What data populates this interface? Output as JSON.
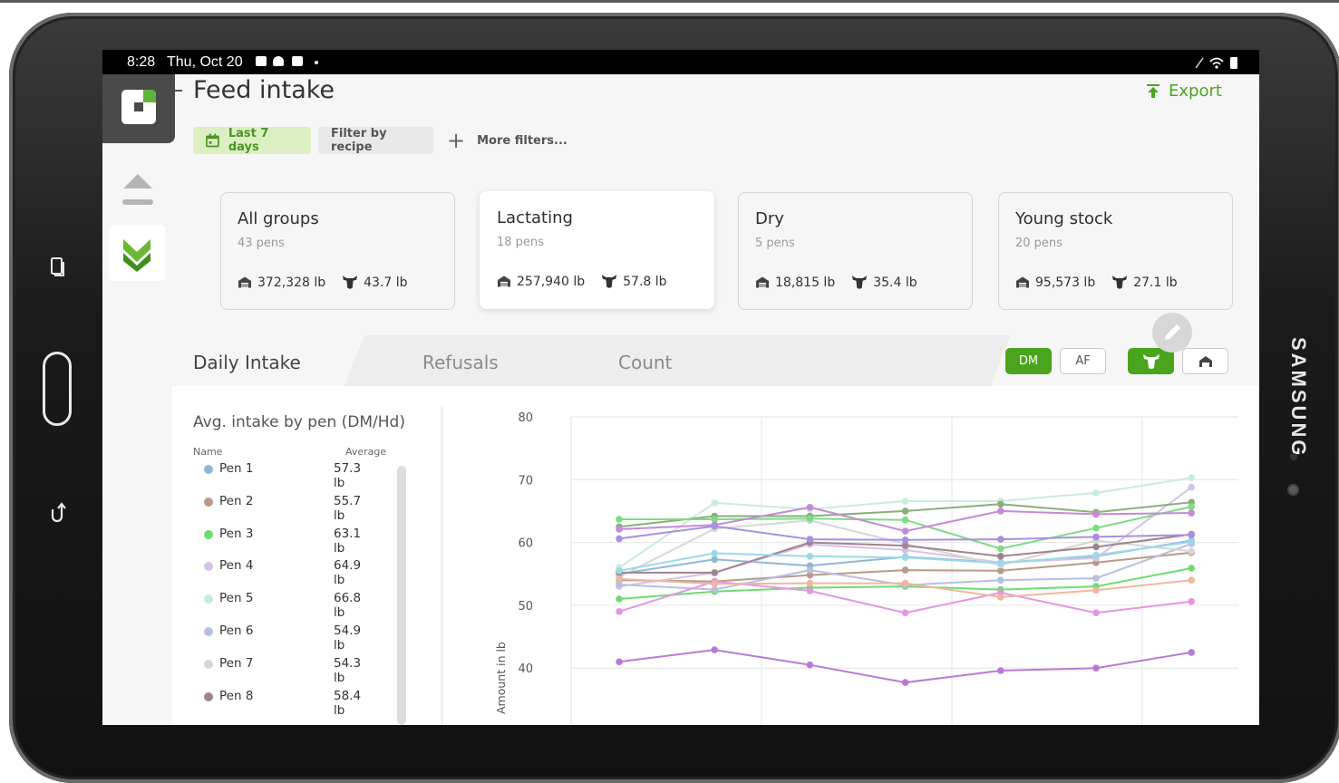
{
  "status_bar": {
    "time": "8:28",
    "date": "Thu, Oct 20"
  },
  "device_brand": "SAMSUNG",
  "page": {
    "title": "Feed intake",
    "export_label": "Export"
  },
  "filters": {
    "date_range": "Last 7 days",
    "recipe": "Filter by recipe",
    "more": "More filters..."
  },
  "groups": [
    {
      "name": "All groups",
      "pens": "43 pens",
      "total": "372,328 lb",
      "per_head": "43.7 lb",
      "active": false
    },
    {
      "name": "Lactating",
      "pens": "18 pens",
      "total": "257,940 lb",
      "per_head": "57.8 lb",
      "active": true
    },
    {
      "name": "Dry",
      "pens": "5 pens",
      "total": "18,815 lb",
      "per_head": "35.4 lb",
      "active": false
    },
    {
      "name": "Young stock",
      "pens": "20 pens",
      "total": "95,573 lb",
      "per_head": "27.1 lb",
      "active": false
    }
  ],
  "tabs": {
    "daily": "Daily Intake",
    "refusals": "Refusals",
    "count": "Count"
  },
  "toggles": {
    "dm": "DM",
    "af": "AF"
  },
  "pen_list": {
    "title": "Avg. intake by pen (DM/Hd)",
    "col_name": "Name",
    "col_avg": "Average",
    "rows": [
      {
        "name": "Pen 1",
        "avg": "57.3 lb",
        "color": "#8fb8d6"
      },
      {
        "name": "Pen 2",
        "avg": "55.7 lb",
        "color": "#b89a86"
      },
      {
        "name": "Pen 3",
        "avg": "63.1 lb",
        "color": "#6fdc6f"
      },
      {
        "name": "Pen 4",
        "avg": "64.9 lb",
        "color": "#d6c2e8"
      },
      {
        "name": "Pen 5",
        "avg": "66.8 lb",
        "color": "#c9ecdc"
      },
      {
        "name": "Pen 6",
        "avg": "54.9 lb",
        "color": "#b7bfe0"
      },
      {
        "name": "Pen 7",
        "avg": "54.3 lb",
        "color": "#d6d6d6"
      },
      {
        "name": "Pen 8",
        "avg": "58.4 lb",
        "color": "#a1838d"
      }
    ]
  },
  "chart_data": {
    "type": "line",
    "ylabel": "Amount in lb",
    "ylim": [
      40,
      80
    ],
    "yticks": [
      40,
      50,
      60,
      70,
      80
    ],
    "grid": true,
    "points_per_series": 7,
    "series": [
      {
        "color": "#8fb8d6",
        "values": [
          55,
          57.3,
          56.3,
          57.7,
          56.8,
          57.8,
          60.3
        ]
      },
      {
        "color": "#b89a86",
        "values": [
          54,
          53.8,
          54.8,
          55.6,
          55.5,
          56.8,
          58.4
        ]
      },
      {
        "color": "#6fdc6f",
        "values": [
          51,
          52.2,
          52.8,
          53,
          52.5,
          53,
          55.9
        ]
      },
      {
        "color": "#d6c2e8",
        "values": [
          53,
          55.2,
          59.7,
          58.8,
          56.8,
          57.5,
          68.8
        ]
      },
      {
        "color": "#c9ecdc",
        "values": [
          56,
          66.3,
          65.3,
          66.6,
          66.6,
          67.9,
          70.3
        ]
      },
      {
        "color": "#b7bfe0",
        "values": [
          53.3,
          52.5,
          55.6,
          53.2,
          54,
          54.3,
          59.8
        ]
      },
      {
        "color": "#d6d6d6",
        "values": [
          54.5,
          62.2,
          63.5,
          59.8,
          56.4,
          60.3,
          58.6
        ]
      },
      {
        "color": "#a1838d",
        "values": [
          55.2,
          55.2,
          60,
          59.5,
          57.8,
          59.3,
          61.3
        ]
      },
      {
        "color": "#9bd9ea",
        "values": [
          55.5,
          58.3,
          57.8,
          57.6,
          56.7,
          58,
          60.1
        ]
      },
      {
        "color": "#8bae7a",
        "values": [
          62.5,
          64.2,
          64.2,
          65,
          66.1,
          64.8,
          66.4
        ]
      },
      {
        "color": "#7bdc84",
        "values": [
          63.7,
          63.7,
          63.8,
          63.6,
          59,
          62.3,
          65.7
        ]
      },
      {
        "color": "#c68ad6",
        "values": [
          62.1,
          62.8,
          65.6,
          61.8,
          65,
          64.5,
          64.7
        ]
      },
      {
        "color": "#a88fe0",
        "values": [
          60.6,
          62.6,
          60.5,
          60.4,
          60.5,
          60.9,
          61.2
        ]
      },
      {
        "color": "#e495e4",
        "values": [
          49,
          53.8,
          52.3,
          48.8,
          52,
          48.8,
          50.6
        ]
      },
      {
        "color": "#f0b7a0",
        "values": [
          54.2,
          53.4,
          53.5,
          53.5,
          51.3,
          52.4,
          54
        ]
      },
      {
        "color": "#b97ad6",
        "values": [
          41,
          42.9,
          40.5,
          37.7,
          39.6,
          40,
          42.5
        ]
      }
    ]
  }
}
